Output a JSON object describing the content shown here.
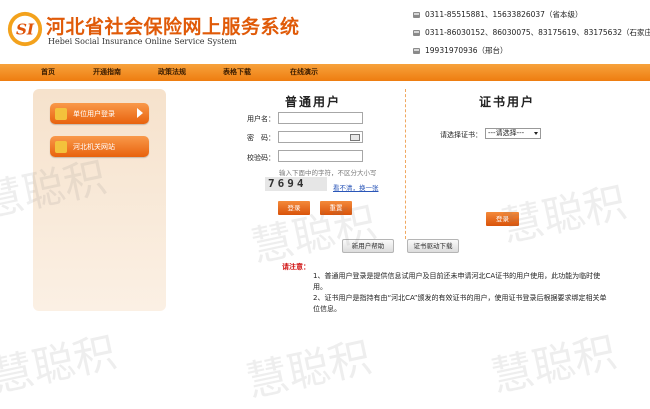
{
  "header": {
    "title": "河北省社会保险网上服务系统",
    "subtitle": "Hebei Social Insurance Online Service System",
    "logo_text": "SI",
    "contacts": [
      "0311-85515881、15633826037（省本级）",
      "0311-86030152、86030075、83175619、83175632（石家庄市）",
      "19931970936（邢台）"
    ]
  },
  "nav": {
    "items": [
      "首页",
      "开通指南",
      "政策法规",
      "表格下载",
      "在线演示"
    ]
  },
  "sidebar": {
    "unit_login_label": "单位用户登录",
    "gov_site_label": "河北机关网站"
  },
  "login": {
    "title": "普通用户",
    "username_label": "用户名：",
    "password_label": "密　码：",
    "captcha_label": "校验码：",
    "captcha_hint": "输入下面中的字符，不区分大小写",
    "captcha_text": "7694",
    "refresh_link": "看不清，换一张",
    "login_button": "登录",
    "reset_button": "重置"
  },
  "cert": {
    "title": "证书用户",
    "select_label": "请选择证书：",
    "select_value": "---请选择---",
    "login_button": "登录"
  },
  "help": {
    "new_user_help": "新用户帮助",
    "cert_driver_download": "证书驱动下载"
  },
  "notice": {
    "title": "请注意：",
    "items": [
      "1、普通用户登录是提供信息试用户及目前还未申请河北CA证书的用户使用，此功能为临时使用。",
      "2、证书用户是指持有由“河北CA”颁发的有效证书的用户，使用证书登录后根据要求绑定相关单位信息。"
    ]
  },
  "watermark": "慧聪积",
  "colors": {
    "brand_orange": "#ee7d10",
    "title_orange": "#e05a08",
    "notice_red": "#d01212"
  }
}
